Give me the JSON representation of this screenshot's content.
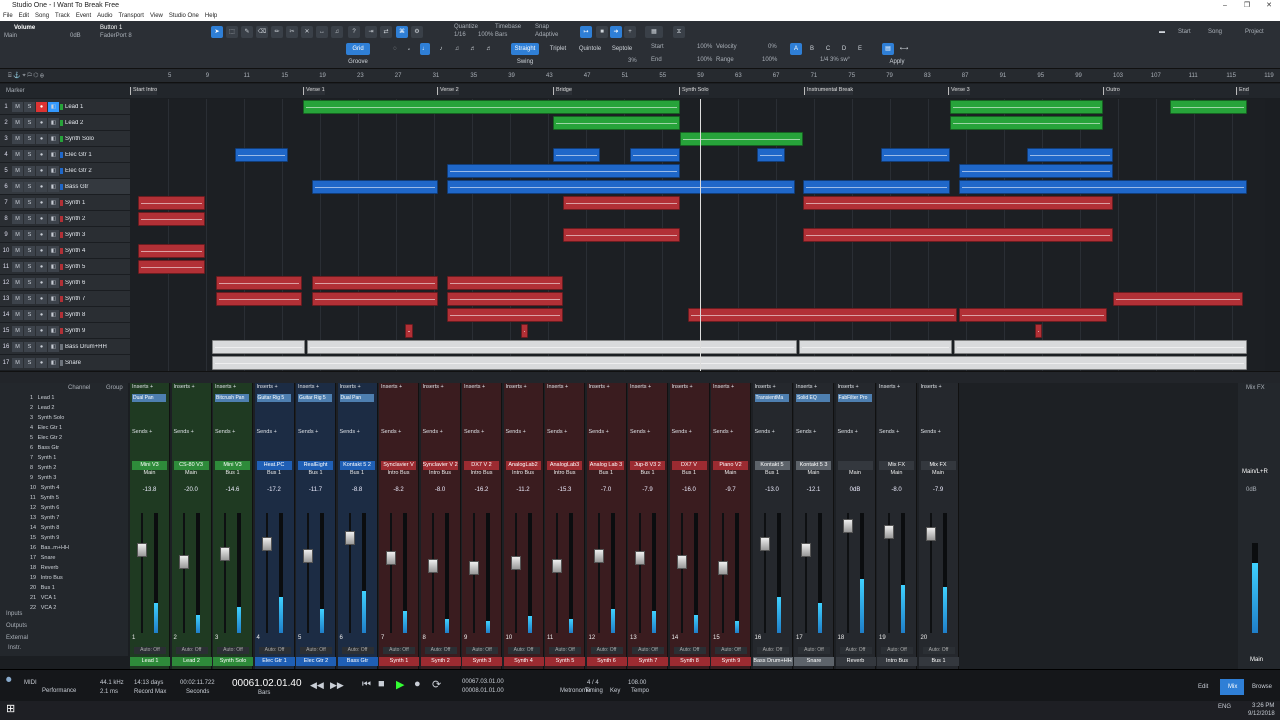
{
  "window": {
    "title": "Studio One - I Want To Break Free",
    "controls": [
      "–",
      "❐",
      "✕"
    ]
  },
  "menu": [
    "File",
    "Edit",
    "Song",
    "Track",
    "Event",
    "Audio",
    "Transport",
    "View",
    "Studio One",
    "Help"
  ],
  "toolbar": {
    "param_name": "Volume",
    "param_sub": "Main",
    "param_value": "0dB",
    "button_name": "Button 1",
    "button_sub": "FaderPort 8",
    "quantize_label": "Quantize",
    "quantize_value": "1/16",
    "quantize_pct": "100%",
    "timebase_label": "Timebase",
    "timebase_value": "Bars",
    "snap_label": "Snap",
    "snap_value": "Adaptive",
    "grid": "Grid",
    "groove": "Groove",
    "straight": "Straight",
    "swing": "Swing",
    "triplet": "Triplet",
    "quintole": "Quintole",
    "septole": "Septole",
    "swing_pct": "3%",
    "start": "Start",
    "end": "End",
    "start_pct": "100%",
    "end_pct": "100%",
    "velocity": "Velocity",
    "range": "Range",
    "vel_pct": "0%",
    "range_pct": "100%",
    "letters": [
      "A",
      "B",
      "C",
      "D",
      "E"
    ],
    "apply": "Apply",
    "quant_readout": "1/4 3% sw°",
    "right_tabs": [
      "Start",
      "Song",
      "Project"
    ]
  },
  "ruler": {
    "ticks": [
      "5",
      "9",
      "11",
      "15",
      "19",
      "23",
      "27",
      "31",
      "35",
      "39",
      "43",
      "47",
      "51",
      "55",
      "59",
      "63",
      "67",
      "71",
      "75",
      "79",
      "83",
      "87",
      "91",
      "95",
      "99",
      "103",
      "107",
      "111",
      "115",
      "119"
    ]
  },
  "markers": {
    "row_label": "Marker",
    "items": [
      "Start Intro",
      "Verse 1",
      "Verse 2",
      "Bridge",
      "Synth Solo",
      "Instrumental Break",
      "Verse 3",
      "Outro",
      "End"
    ]
  },
  "tracks": [
    {
      "num": "1",
      "name": "Lead 1",
      "color": "#27a33a"
    },
    {
      "num": "2",
      "name": "Lead 2",
      "color": "#27a33a"
    },
    {
      "num": "3",
      "name": "Synth Solo",
      "color": "#27a33a"
    },
    {
      "num": "4",
      "name": "Elec Gtr 1",
      "color": "#1f67c9"
    },
    {
      "num": "5",
      "name": "Elec Gtr 2",
      "color": "#1f67c9"
    },
    {
      "num": "6",
      "name": "Bass Gtr",
      "color": "#1f67c9"
    },
    {
      "num": "7",
      "name": "Synth 1",
      "color": "#b23036"
    },
    {
      "num": "8",
      "name": "Synth 2",
      "color": "#b23036"
    },
    {
      "num": "9",
      "name": "Synth 3",
      "color": "#b23036"
    },
    {
      "num": "10",
      "name": "Synth 4",
      "color": "#b23036"
    },
    {
      "num": "11",
      "name": "Synth 5",
      "color": "#b23036"
    },
    {
      "num": "12",
      "name": "Synth 6",
      "color": "#b23036"
    },
    {
      "num": "13",
      "name": "Synth 7",
      "color": "#b23036"
    },
    {
      "num": "14",
      "name": "Synth 8",
      "color": "#b23036"
    },
    {
      "num": "15",
      "name": "Synth 9",
      "color": "#b23036"
    },
    {
      "num": "16",
      "name": "Bass Drum+HH",
      "color": "#6d737b"
    },
    {
      "num": "17",
      "name": "Snare",
      "color": "#6d737b"
    }
  ],
  "console_header": {
    "channel": "Channel",
    "group": "Group"
  },
  "console_list": [
    "Lead 1",
    "Lead 2",
    "Synth Solo",
    "Elec Gtr 1",
    "Elec Gtr 2",
    "Bass Gtr",
    "Synth 1",
    "Synth 2",
    "Synth 3",
    "Synth 4",
    "Synth 5",
    "Synth 6",
    "Synth 7",
    "Synth 8",
    "Synth 9",
    "Bas..m+HH",
    "Snare",
    "Reverb",
    "Intro Bus",
    "Bus 1",
    "VCA 1",
    "VCA 2"
  ],
  "console_side": [
    "Inputs",
    "Outputs",
    "External",
    "Instr."
  ],
  "strips": [
    {
      "plug": "Dual Pan",
      "inst": "Mini V3",
      "out": "Main",
      "vol": "-13.8",
      "num": "1",
      "label": "Lead 1",
      "color": "#2e8b3a",
      "level": 0.25
    },
    {
      "plug": "",
      "inst": "CS-80 V3",
      "out": "Main",
      "vol": "-20.0",
      "num": "2",
      "label": "Lead 2",
      "color": "#2e8b3a",
      "level": 0.15
    },
    {
      "plug": "Bitcrush Pan",
      "inst": "Mini V3",
      "out": "Bus 1",
      "vol": "-14.6",
      "num": "3",
      "label": "Synth Solo",
      "color": "#2e8b3a",
      "level": 0.22
    },
    {
      "plug": "Guitar Rig 5",
      "inst": "Heat.PC",
      "out": "Bus 1",
      "vol": "-17.2",
      "num": "4",
      "label": "Elec Gtr 1",
      "color": "#1f5fb5",
      "level": 0.3
    },
    {
      "plug": "Guitar Rig 5",
      "inst": "RealEight",
      "out": "Bus 1",
      "vol": "-11.7",
      "num": "5",
      "label": "Elec Gtr 2",
      "color": "#1f5fb5",
      "level": 0.2
    },
    {
      "plug": "Dual Pan",
      "inst": "Kontakt 5 2",
      "out": "Bus 1",
      "vol": "-8.8",
      "num": "6",
      "label": "Bass Gtr",
      "color": "#1f5fb5",
      "level": 0.35
    },
    {
      "plug": "",
      "inst": "Synclavier V",
      "out": "Intro Bus",
      "vol": "-8.2",
      "num": "7",
      "label": "Synth 1",
      "color": "#9c2b31",
      "level": 0.18
    },
    {
      "plug": "",
      "inst": "Synclavier V 2",
      "out": "Intro Bus",
      "vol": "-8.0",
      "num": "8",
      "label": "Synth 2",
      "color": "#9c2b31",
      "level": 0.12
    },
    {
      "plug": "",
      "inst": "DX7 V 2",
      "out": "Intro Bus",
      "vol": "-16.2",
      "num": "9",
      "label": "Synth 3",
      "color": "#9c2b31",
      "level": 0.1
    },
    {
      "plug": "",
      "inst": "AnalogLab2",
      "out": "Intro Bus",
      "vol": "-11.2",
      "num": "10",
      "label": "Synth 4",
      "color": "#9c2b31",
      "level": 0.14
    },
    {
      "plug": "",
      "inst": "AnalogLab3",
      "out": "Intro Bus",
      "vol": "-15.3",
      "num": "11",
      "label": "Synth 5",
      "color": "#9c2b31",
      "level": 0.12
    },
    {
      "plug": "",
      "inst": "Analog Lab 3",
      "out": "Bus 1",
      "vol": "-7.0",
      "num": "12",
      "label": "Synth 6",
      "color": "#9c2b31",
      "level": 0.2
    },
    {
      "plug": "",
      "inst": "Jup-8 V3 2",
      "out": "Bus 1",
      "vol": "-7.9",
      "num": "13",
      "label": "Synth 7",
      "color": "#9c2b31",
      "level": 0.18
    },
    {
      "plug": "",
      "inst": "DX7 V",
      "out": "Bus 1",
      "vol": "-16.0",
      "num": "14",
      "label": "Synth 8",
      "color": "#9c2b31",
      "level": 0.15
    },
    {
      "plug": "",
      "inst": "Piano V2",
      "out": "Main",
      "vol": "-9.7",
      "num": "15",
      "label": "Synth 9",
      "color": "#9c2b31",
      "level": 0.1
    },
    {
      "plug": "TransientMa",
      "inst": "Kontakt 5",
      "out": "Bus 1",
      "vol": "-13.0",
      "num": "16",
      "label": "Bass Drum+HH",
      "color": "#5d636a",
      "level": 0.3
    },
    {
      "plug": "Solid EQ",
      "inst": "Kontakt 5 3",
      "out": "Main",
      "vol": "-12.1",
      "num": "17",
      "label": "Snare",
      "color": "#5d636a",
      "level": 0.25
    },
    {
      "plug": "FabFilter Pro",
      "inst": "",
      "out": "Main",
      "vol": "0dB",
      "num": "18",
      "label": "Reverb",
      "color": "#34383e",
      "level": 0.45
    },
    {
      "plug": "",
      "inst": "Mix FX",
      "out": "Main",
      "vol": "-8.0",
      "num": "19",
      "label": "Intro Bus",
      "color": "#34383e",
      "level": 0.4
    },
    {
      "plug": "",
      "inst": "Mix FX",
      "out": "Main",
      "vol": "-7.9",
      "num": "20",
      "label": "Bus 1",
      "color": "#34383e",
      "level": 0.38
    }
  ],
  "main_strip": {
    "title": "Mix FX",
    "name": "Main/L+R",
    "vol": "0dB",
    "label": "Main"
  },
  "transport": {
    "sample_rate": "44.1 kHz",
    "latency": "2.1 ms",
    "record_max": "14:13 days",
    "seconds": "00:02:11.722",
    "position": "00061.02.01.40",
    "bars_label": "Bars",
    "loop_start": "00067.03.01.00",
    "loop_end": "00008.01.01.00",
    "signature": "4 / 4",
    "tempo": "108.00",
    "tempo_label": "Tempo",
    "metronome": "Metronome",
    "timing": "Timing",
    "key": "Key",
    "performance": "Performance",
    "midi": "MIDI",
    "record_max_label": "Record Max",
    "seconds_label": "Seconds",
    "views": [
      "Edit",
      "Mix",
      "Browse"
    ],
    "remote": "Remote"
  },
  "taskbar": {
    "time": "3:26 PM",
    "date": "9/12/2018",
    "lang": "ENG"
  }
}
